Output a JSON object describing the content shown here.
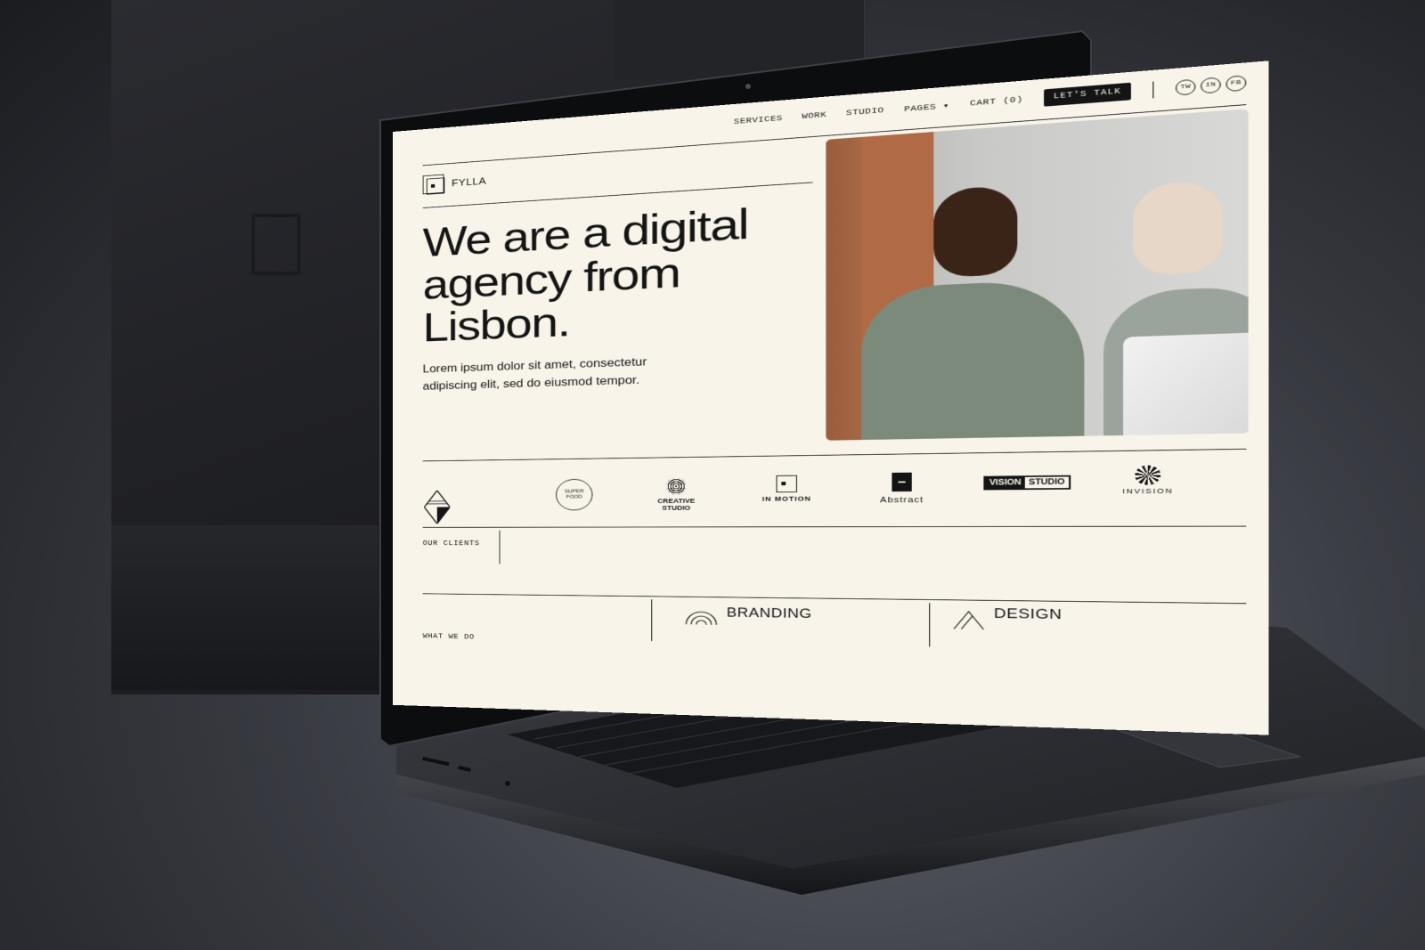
{
  "site": {
    "brand": "FYLLA",
    "nav": {
      "services": "SERVICES",
      "work": "WORK",
      "studio": "STUDIO",
      "pages": "PAGES",
      "cart": "CART (0)",
      "cta": "LET'S TALK"
    },
    "socials": [
      "TW",
      "IN",
      "FB"
    ],
    "hero": {
      "title": "We are a digital agency from Lisbon.",
      "subtitle": "Lorem ipsum dolor sit amet, consectetur adipiscing elit, sed do eiusmod tempor."
    },
    "clients": {
      "label": "OUR CLIENTS",
      "logos": [
        {
          "name": "SUPER FOOD",
          "icon": "fork-knife-icon"
        },
        {
          "name": "CREATIVE STUDIO",
          "icon": "spiral-icon"
        },
        {
          "name": "IN MOTION",
          "icon": "square-stack-icon"
        },
        {
          "name": "Abstract",
          "icon": "block-icon"
        },
        {
          "name_a": "VISION",
          "name_b": "STUDIO"
        },
        {
          "name": "INVISION",
          "icon": "mandala-icon"
        }
      ]
    },
    "what_we_do": {
      "label": "WHAT WE DO",
      "services": [
        "BRANDING",
        "DESIGN"
      ]
    }
  },
  "colors": {
    "page_bg": "#f8f4ea",
    "ink": "#141414",
    "device": "#1c1d21"
  }
}
